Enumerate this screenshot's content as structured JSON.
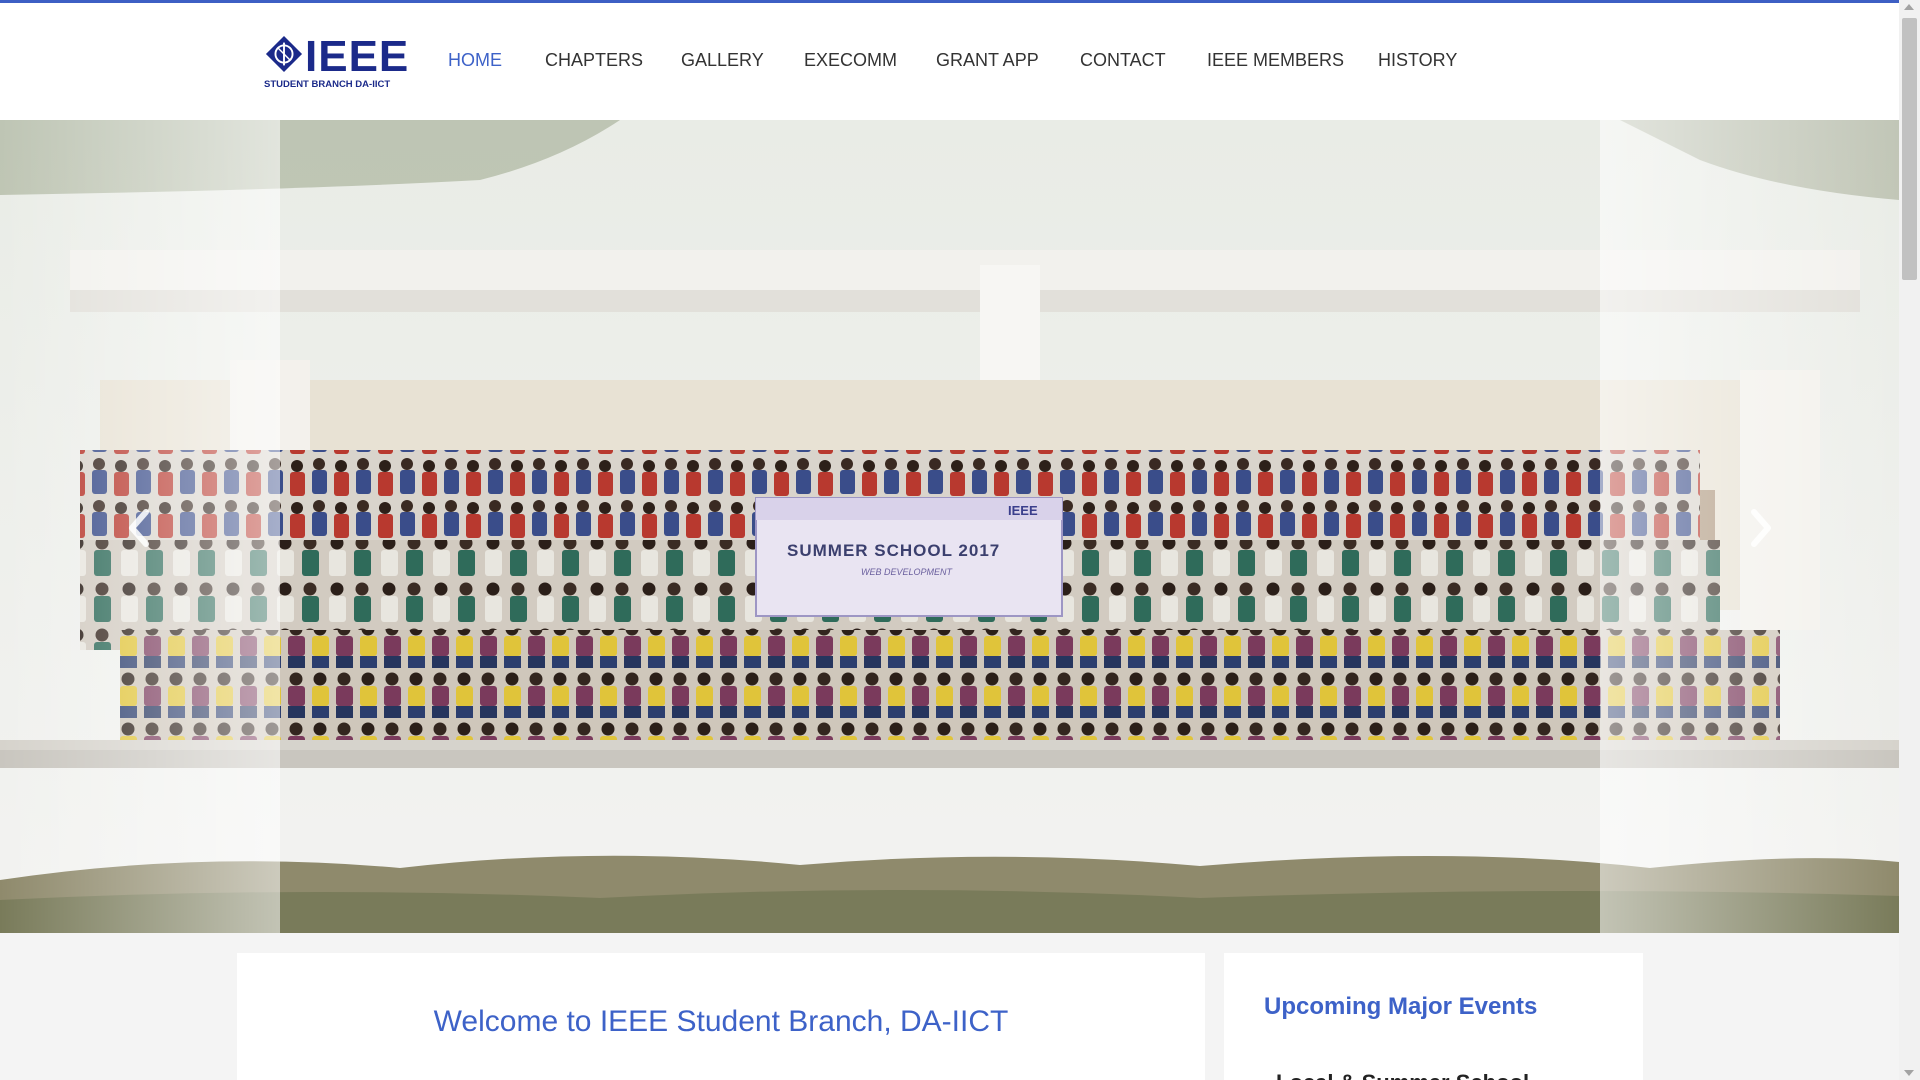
{
  "brand": {
    "name": "IEEE",
    "subtitle": "STUDENT BRANCH DA-IICT"
  },
  "nav": {
    "items": [
      {
        "label": "HOME",
        "active": true
      },
      {
        "label": "CHAPTERS",
        "active": false
      },
      {
        "label": "GALLERY",
        "active": false
      },
      {
        "label": "EXECOMM",
        "active": false
      },
      {
        "label": "GRANT APP",
        "active": false
      },
      {
        "label": "CONTACT",
        "active": false
      },
      {
        "label": "IEEE MEMBERS",
        "active": false
      },
      {
        "label": "HISTORY",
        "active": false
      }
    ]
  },
  "hero": {
    "banner_title": "SUMMER SCHOOL 2017",
    "banner_subtitle": "WEB DEVELOPMENT",
    "banner_logo": "IEEE",
    "prev_icon": "chevron-left-icon",
    "next_icon": "chevron-right-icon"
  },
  "main": {
    "welcome": "Welcome to IEEE Student Branch, DA-IICT"
  },
  "sidebar": {
    "title": "Upcoming Major Events",
    "first_item": "Local & Summer School"
  },
  "colors": {
    "accent": "#3d62c8",
    "brand": "#1b2a8a",
    "top_border": "#3d5fc4",
    "page_bg": "#f4f4f4"
  }
}
